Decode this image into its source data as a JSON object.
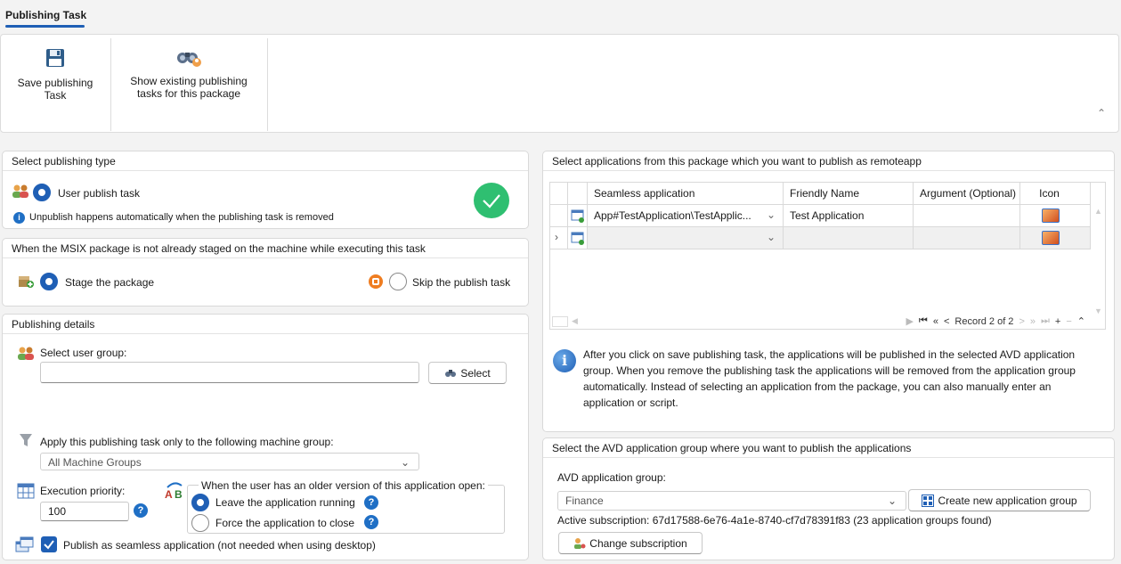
{
  "tab": {
    "title": "Publishing Task"
  },
  "ribbon": {
    "save_label": "Save publishing\nTask",
    "show_label": "Show existing publishing\ntasks for this package",
    "collapse_icon": "chevron-up-icon"
  },
  "publishing_type": {
    "header": "Select publishing type",
    "user_publish_label": "User publish task",
    "note": "Unpublish happens automatically when the publishing task is removed"
  },
  "staging": {
    "header": "When the MSIX package is not already staged on the machine while executing this task",
    "stage_label": "Stage the package",
    "skip_label": "Skip the publish task"
  },
  "details": {
    "header": "Publishing details",
    "user_group_label": "Select user group:",
    "user_group_value": "",
    "select_button": "Select",
    "machine_group_label": "Apply this publishing task only to the following machine group:",
    "machine_group_value": "All Machine Groups",
    "priority_label": "Execution priority:",
    "priority_value": "100",
    "older_version_label": "When the user has an older version of this application open:",
    "leave_running_label": "Leave the application running",
    "force_close_label": "Force the application to close",
    "seamless_label": "Publish as seamless application (not needed when using desktop)",
    "seamless_checked": true
  },
  "apps": {
    "header": "Select applications from this package which you want to publish as remoteapp",
    "columns": [
      "Seamless application",
      "Friendly Name",
      "Argument (Optional)",
      "Icon"
    ],
    "rows": [
      {
        "seamless": "App#TestApplication\\TestApplic...",
        "friendly": "Test Application",
        "argument": ""
      },
      {
        "seamless": "",
        "friendly": "",
        "argument": ""
      }
    ],
    "pager": "Record 2 of 2",
    "info": "After you click on save publishing task, the applications will be published in the selected AVD application group. When you remove the publishing task the applications will be removed from the application group automatically. Instead of selecting an application from the package, you can also manually enter an application or script."
  },
  "avd": {
    "header": "Select the AVD application group where you want to publish the applications",
    "group_label": "AVD application group:",
    "group_value": "Finance",
    "create_button": "Create new application group",
    "subscription": "Active subscription: 67d17588-6e76-4a1e-8740-cf7d78391f83 (23 application groups found)",
    "change_button": "Change subscription"
  },
  "colors": {
    "accent": "#1f5fb5",
    "success": "#2fbf71",
    "help": "#1f6fc5"
  }
}
